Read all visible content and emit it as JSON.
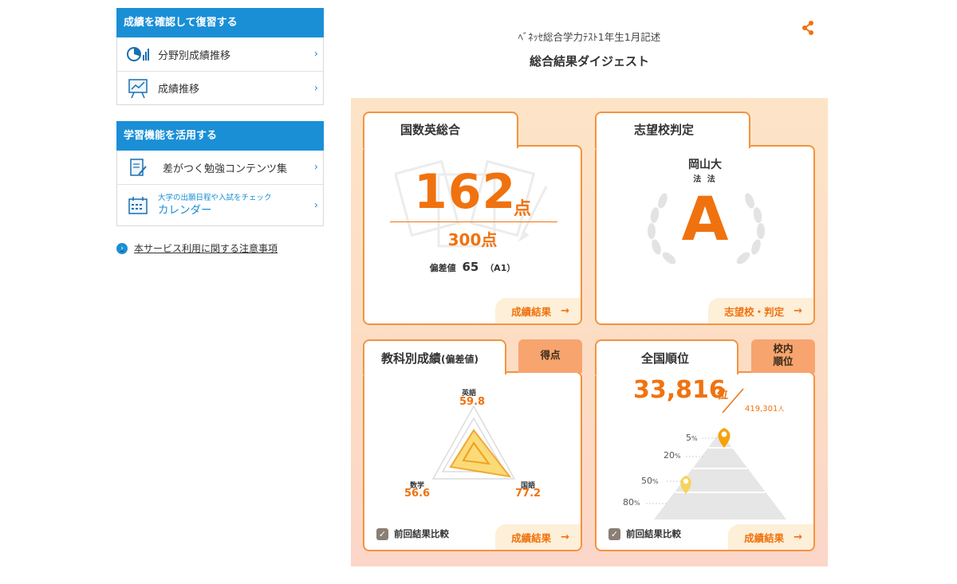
{
  "sidebar": {
    "review": {
      "heading": "成績を確認して復習する",
      "items": [
        {
          "label": "分野別成績推移",
          "icon": "pie-chart-icon"
        },
        {
          "label": "成績推移",
          "icon": "line-chart-board-icon"
        }
      ]
    },
    "study": {
      "heading": "学習機能を活用する",
      "items": [
        {
          "label": "差がつく勉強コンテンツ集",
          "icon": "notebook-pen-icon"
        },
        {
          "sublabel": "大学の出願日程や入試をチェック",
          "label": "カレンダー",
          "icon": "calendar-icon"
        }
      ]
    },
    "notice": "本サービス利用に関する注意事項",
    "chevron": "›"
  },
  "header": {
    "exam_title": "ﾍﾞﾈｯｾ総合学力ﾃｽﾄ1年生1月記述",
    "digest_title": "総合結果ダイジェスト",
    "share_icon": "share-icon"
  },
  "total_score": {
    "title": "国数英総合",
    "score": "162",
    "score_unit": "点",
    "max": "300点",
    "deviation_label": "偏差値",
    "deviation_value": "65",
    "deviation_grade": "（A1）",
    "button": "成績結果",
    "arrow": "→"
  },
  "school_judgement": {
    "title": "志望校判定",
    "school": "岡山大",
    "faculty": "法 法",
    "grade": "A",
    "button": "志望校・判定",
    "arrow": "→"
  },
  "subject_scores": {
    "title": "教科別成績",
    "title_sub": "(偏差値)",
    "badge": "得点",
    "subjects": [
      {
        "name": "英語",
        "value": "59.8"
      },
      {
        "name": "国語",
        "value": "77.2"
      },
      {
        "name": "数学",
        "value": "56.6"
      }
    ],
    "compare_label": "前回結果比較",
    "check_mark": "✓",
    "button": "成績結果",
    "arrow": "→"
  },
  "national_rank": {
    "title": "全国順位",
    "badge_line1": "校内",
    "badge_line2": "順位",
    "rank": "33,816",
    "rank_unit": "位",
    "total": "419,301",
    "total_unit": "人",
    "levels": [
      {
        "value": "5",
        "unit": "%"
      },
      {
        "value": "20",
        "unit": "%"
      },
      {
        "value": "50",
        "unit": "%"
      },
      {
        "value": "80",
        "unit": "%"
      }
    ],
    "compare_label": "前回結果比較",
    "check_mark": "✓",
    "button": "成績結果",
    "arrow": "→"
  },
  "colors": {
    "accent": "#f0720f",
    "card_border": "#f39340",
    "sidebar_blue": "#1a8fd6",
    "panel_bg": "#fde4c7"
  }
}
